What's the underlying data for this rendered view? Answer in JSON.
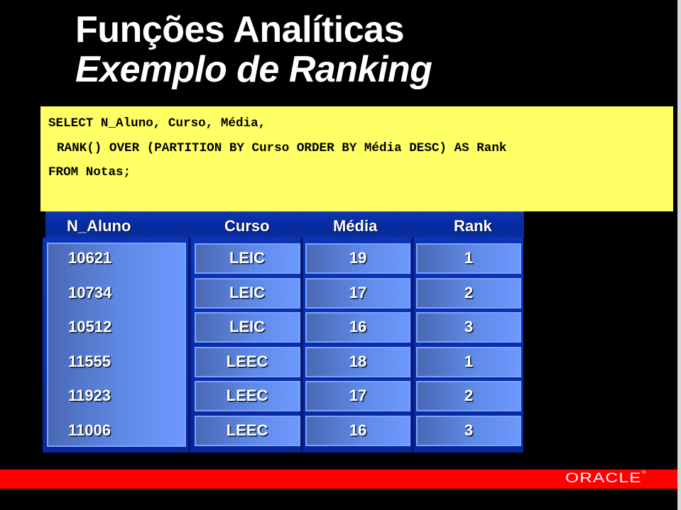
{
  "slide": {
    "title_line1": "Funções Analíticas",
    "title_line2": "Exemplo de Ranking",
    "sql": [
      "SELECT N_Aluno, Curso, Média,",
      "RANK() OVER (PARTITION BY Curso ORDER BY Média DESC) AS Rank",
      "FROM Notas;"
    ],
    "table": {
      "headers": [
        "N_Aluno",
        "Curso",
        "Média",
        "Rank"
      ],
      "rows": [
        [
          "10621",
          "LEIC",
          "19",
          "1"
        ],
        [
          "10734",
          "LEIC",
          "17",
          "2"
        ],
        [
          "10512",
          "LEIC",
          "16",
          "3"
        ],
        [
          "11555",
          "LEEC",
          "18",
          "1"
        ],
        [
          "11923",
          "LEEC",
          "17",
          "2"
        ],
        [
          "11006",
          "LEEC",
          "16",
          "3"
        ]
      ]
    },
    "footer": {
      "logo_text": "ORACLE",
      "logo_mark": "®"
    },
    "colors": {
      "background": "#000000",
      "title": "#ffffff",
      "sql_box": "#ffff66",
      "header_bar": "#06299c",
      "cell_light": "#6d99ff",
      "footer_bar": "#ff0000"
    }
  }
}
